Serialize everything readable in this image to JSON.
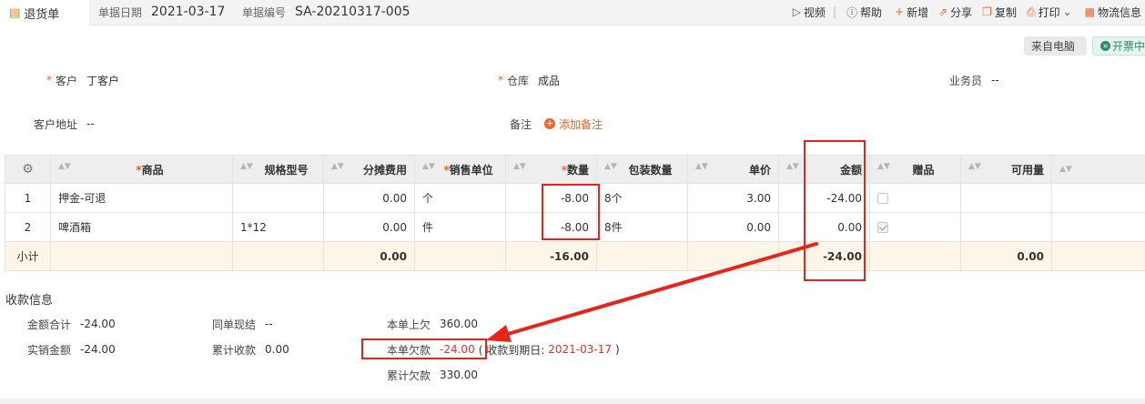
{
  "header": {
    "tab_title": "退货单",
    "date_label": "单据日期",
    "date_value": "2021-03-17",
    "no_label": "单据编号",
    "no_value": "SA-20210317-005"
  },
  "actions": {
    "video": "视频",
    "divider": "|",
    "help": "帮助",
    "new": "新增",
    "share": "分享",
    "copy": "复制",
    "print": "打印",
    "logistics": "物流信息"
  },
  "tags": {
    "source": "来自电脑",
    "invoice": "开票中"
  },
  "form": {
    "required_mark": "*",
    "customer_label": "客户",
    "customer_value": "丁客户",
    "warehouse_label": "仓库",
    "warehouse_value": "成品",
    "salesman_label": "业务员",
    "salesman_value": "--",
    "address_label": "客户地址",
    "address_value": "--",
    "remark_label": "备注",
    "add_remark": "添加备注"
  },
  "table": {
    "headers": {
      "product": "商品",
      "spec": "规格型号",
      "alloc_fee": "分摊费用",
      "unit": "销售单位",
      "qty": "数量",
      "pack_qty": "包装数量",
      "price": "单价",
      "amount": "金额",
      "gift": "赠品",
      "available": "可用量"
    },
    "rows": [
      {
        "idx": "1",
        "product": "押金-可退",
        "spec": "",
        "alloc_fee": "0.00",
        "unit": "个",
        "qty": "-8.00",
        "pack_qty": "8个",
        "price": "3.00",
        "amount": "-24.00",
        "gift": false,
        "available": ""
      },
      {
        "idx": "2",
        "product": "啤酒箱",
        "spec": "1*12",
        "alloc_fee": "0.00",
        "unit": "件",
        "qty": "-8.00",
        "pack_qty": "8件",
        "price": "0.00",
        "amount": "0.00",
        "gift": true,
        "available": ""
      }
    ],
    "subtotal": {
      "label": "小计",
      "alloc_fee": "0.00",
      "qty": "-16.00",
      "amount": "-24.00",
      "available": "0.00"
    }
  },
  "payment": {
    "title": "收款信息",
    "total_amount_label": "金额合计",
    "total_amount_value": "-24.00",
    "same_settle_label": "同单现结",
    "same_settle_value": "--",
    "prev_owed_label": "本单上欠",
    "prev_owed_value": "360.00",
    "actual_sales_label": "实销金额",
    "actual_sales_value": "-24.00",
    "cum_received_label": "累计收款",
    "cum_received_value": "0.00",
    "this_owed_label": "本单欠款",
    "this_owed_value": "-24.00",
    "due_prefix": "( 收款到期日:",
    "due_date": "2021-03-17",
    "due_suffix": ")",
    "cum_owed_label": "累计欠款",
    "cum_owed_value": "330.00"
  },
  "colors": {
    "accent": "#f0632c",
    "annotation": "#e8231a",
    "subtotal_bg": "#fdf5e7",
    "invoice_green": "#2b8d68"
  }
}
